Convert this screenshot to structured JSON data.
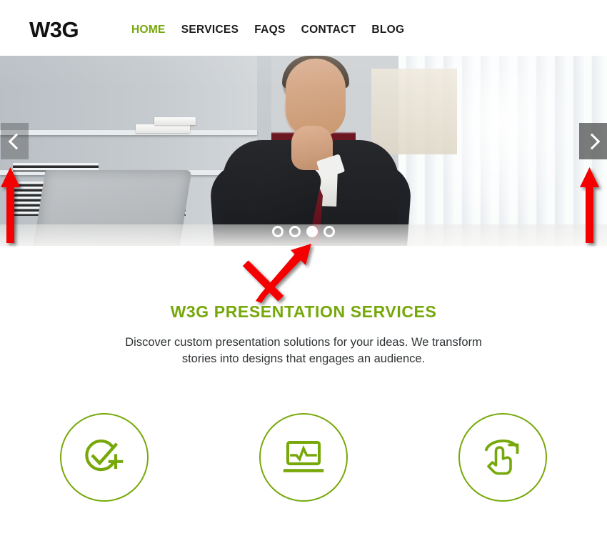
{
  "site": {
    "logo_text": "W3G"
  },
  "nav": {
    "items": [
      {
        "label": "HOME",
        "active": true
      },
      {
        "label": "SERVICES",
        "active": false
      },
      {
        "label": "FAQS",
        "active": false
      },
      {
        "label": "CONTACT",
        "active": false
      },
      {
        "label": "BLOG",
        "active": false
      }
    ]
  },
  "hero": {
    "prev_icon": "chevron-left-icon",
    "next_icon": "chevron-right-icon",
    "slide_count": 4,
    "active_slide": 3,
    "image_alt": "Businessman in dark suit thinking at office desk with laptop"
  },
  "section": {
    "title": "W3G PRESENTATION SERVICES",
    "description": "Discover custom presentation solutions for your ideas. We transform stories into designs that engages an audience."
  },
  "features": [
    {
      "icon": "check-circle-plus-icon",
      "label": ""
    },
    {
      "icon": "monitor-chart-icon",
      "label": ""
    },
    {
      "icon": "hand-rotate-icon",
      "label": ""
    }
  ],
  "annotations": [
    {
      "name": "arrow-up-left",
      "points_to": "carousel-prev-button"
    },
    {
      "name": "arrow-up-right",
      "points_to": "carousel-next-button"
    },
    {
      "name": "arrow-diagonal-center",
      "points_to": "carousel-dots"
    }
  ],
  "colors": {
    "accent_green": "#76a80a",
    "text_dark": "#1b1b1b",
    "body_text": "#2f3335",
    "annotation_red": "#f40000"
  }
}
